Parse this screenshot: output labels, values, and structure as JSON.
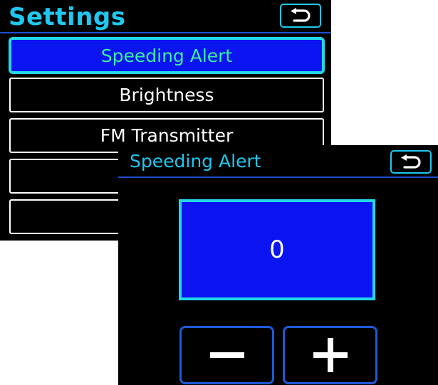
{
  "settings": {
    "title": "Settings",
    "back_icon": "return-arrow-icon",
    "menu_items": [
      {
        "label": "Speeding Alert",
        "selected": true
      },
      {
        "label": "Brightness",
        "selected": false
      },
      {
        "label": "FM Transmitter",
        "selected": false
      },
      {
        "label": "",
        "selected": false
      },
      {
        "label": "",
        "selected": false
      }
    ]
  },
  "speeding_alert": {
    "title": "Speeding Alert",
    "back_icon": "return-arrow-icon",
    "value": "0",
    "decrement_icon": "minus-icon",
    "increment_icon": "plus-icon"
  },
  "colors": {
    "background": "#000000",
    "title_cyan": "#1ec8f0",
    "selected_fill": "#0a14f0",
    "selected_border": "#22d8e8",
    "selected_text": "#35f0a0",
    "button_border": "#1e5ad8",
    "text": "#ffffff"
  }
}
